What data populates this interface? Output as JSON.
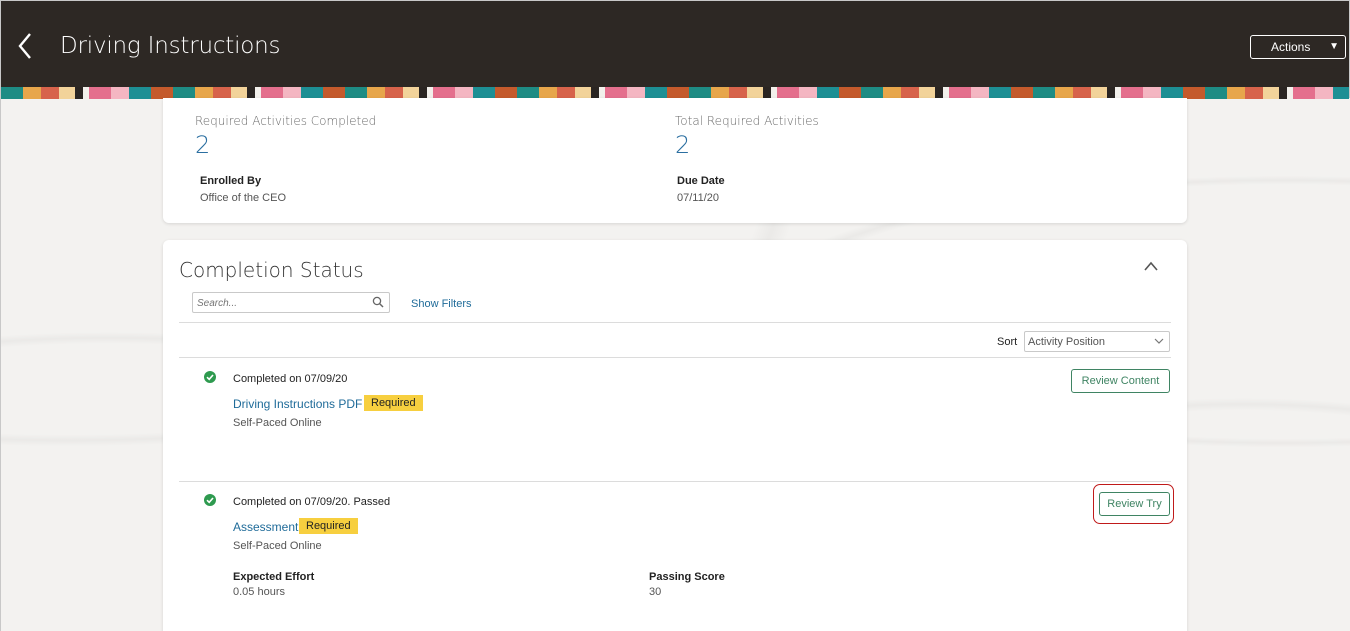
{
  "header": {
    "title": "Driving Instructions",
    "actions_label": "Actions"
  },
  "summary": {
    "completed_label": "Required Activities Completed",
    "completed_value": "2",
    "total_label": "Total Required Activities",
    "total_value": "2",
    "enrolled_by_label": "Enrolled By",
    "enrolled_by_value": "Office of the CEO",
    "due_date_label": "Due Date",
    "due_date_value": "07/11/20"
  },
  "completion": {
    "title": "Completion Status",
    "search_placeholder": "Search...",
    "show_filters": "Show Filters",
    "sort_label": "Sort",
    "sort_value": "Activity Position",
    "activities": [
      {
        "status": "Completed on 07/09/20",
        "name": "Driving Instructions PDF",
        "badge": "Required",
        "type": "Self-Paced Online",
        "button": "Review Content"
      },
      {
        "status": "Completed on 07/09/20. Passed",
        "name": "Assessment",
        "badge": "Required",
        "type": "Self-Paced Online",
        "button": "Review Try",
        "expected_effort_label": "Expected Effort",
        "expected_effort_value": "0.05 hours",
        "passing_score_label": "Passing Score",
        "passing_score_value": "30"
      }
    ]
  },
  "colors": {
    "header_bg": "#2d2824",
    "link": "#1f6b99",
    "metric": "#2b6fa1",
    "badge": "#f7cf3f",
    "success": "#2e9a4f",
    "button_border": "#3f8463",
    "highlight": "#c01a1a"
  }
}
